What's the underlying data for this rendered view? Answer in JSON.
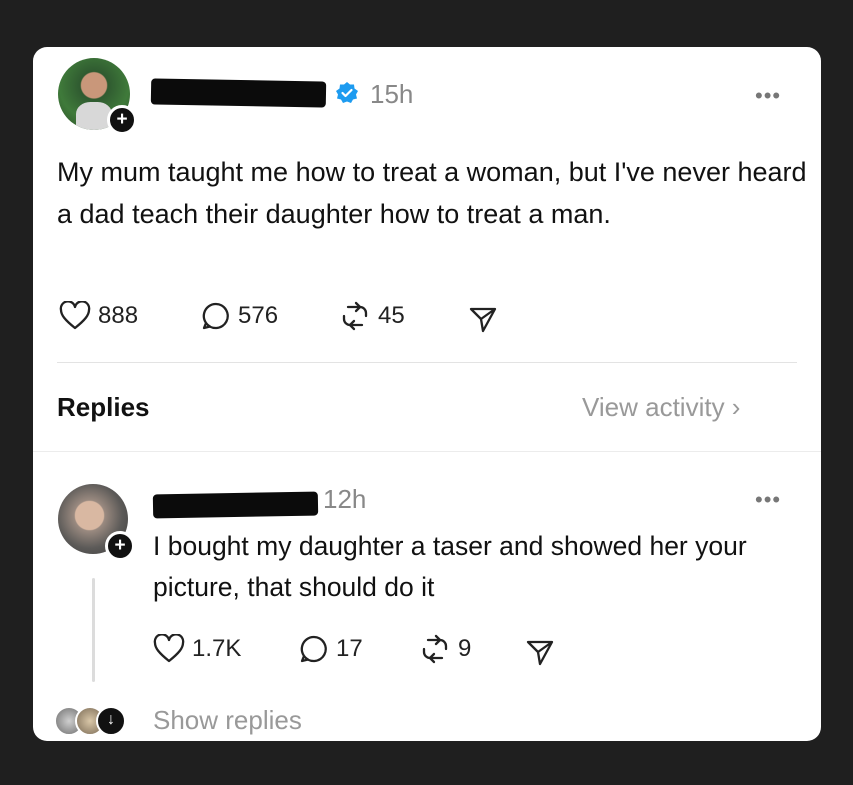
{
  "post": {
    "author_redacted": true,
    "verified": true,
    "time": "15h",
    "more_label": "•••",
    "text": "My mum taught me how to treat a woman, but I've never heard a dad teach their daughter how to treat a man.",
    "likes": "888",
    "comments": "576",
    "reposts": "45"
  },
  "replies_section": {
    "title": "Replies",
    "view_activity": "View activity ›"
  },
  "reply": {
    "author_redacted": true,
    "time": "12h",
    "more_label": "•••",
    "text": "I bought my daughter a taser and showed her your picture, that should do it",
    "likes": "1.7K",
    "comments": "17",
    "reposts": "9",
    "show_replies": "Show replies"
  },
  "colors": {
    "background": "#1f1f1f",
    "card": "#ffffff",
    "verified": "#1d9bf0",
    "muted": "#999999"
  }
}
